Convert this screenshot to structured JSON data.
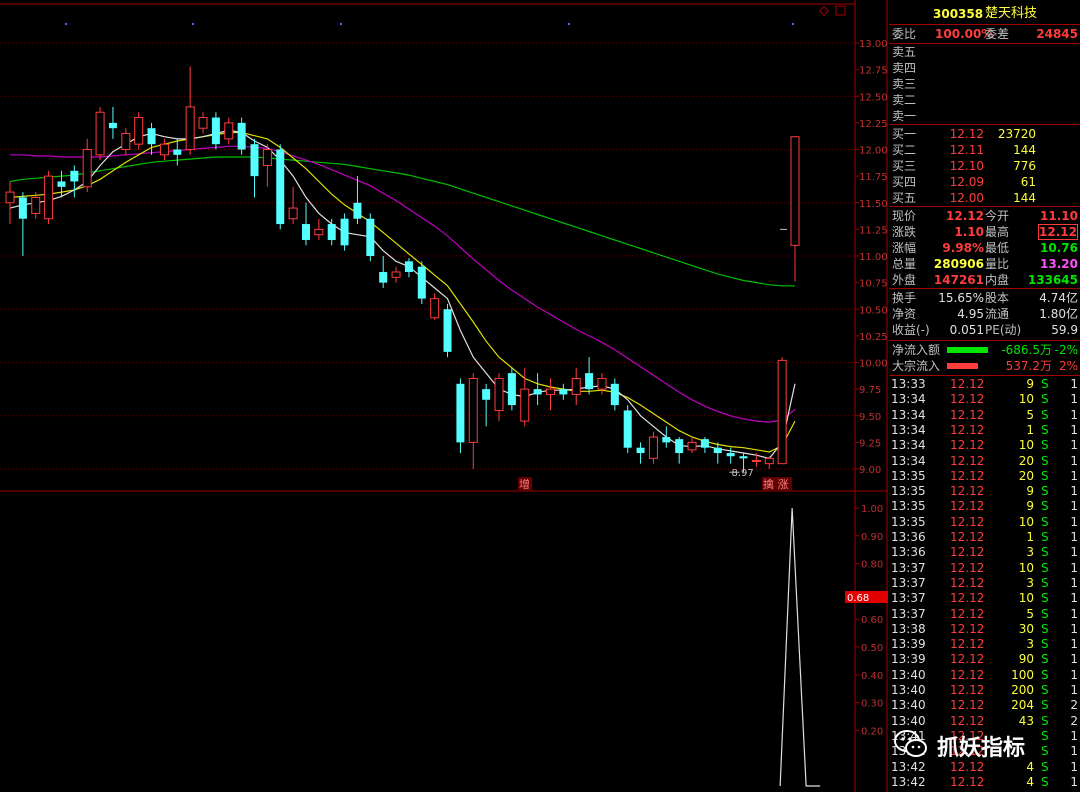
{
  "stock": {
    "code": "300358",
    "name": "楚天科技"
  },
  "weibi": {
    "label": "委比",
    "value": "100.00%",
    "diff_label": "委差",
    "diff_value": "24845"
  },
  "sells": [
    {
      "label": "卖五"
    },
    {
      "label": "卖四"
    },
    {
      "label": "卖三"
    },
    {
      "label": "卖二"
    },
    {
      "label": "卖一"
    }
  ],
  "buys": [
    {
      "label": "买一",
      "price": "12.12",
      "vol": "23720"
    },
    {
      "label": "买二",
      "price": "12.11",
      "vol": "144"
    },
    {
      "label": "买三",
      "price": "12.10",
      "vol": "776"
    },
    {
      "label": "买四",
      "price": "12.09",
      "vol": "61"
    },
    {
      "label": "买五",
      "price": "12.00",
      "vol": "144"
    }
  ],
  "quote": [
    {
      "l1": "现价",
      "v1": "12.12",
      "l2": "今开",
      "v2": "11.10",
      "c1": "red",
      "c2": "red"
    },
    {
      "l1": "涨跌",
      "v1": "1.10",
      "l2": "最高",
      "v2": "12.12",
      "c1": "red",
      "c2": "red"
    },
    {
      "l1": "涨幅",
      "v1": "9.98%",
      "l2": "最低",
      "v2": "10.76",
      "c1": "red",
      "c2": "grn"
    },
    {
      "l1": "总量",
      "v1": "280906",
      "l2": "量比",
      "v2": "13.20",
      "c1": "yel",
      "c2": "mag"
    },
    {
      "l1": "外盘",
      "v1": "147261",
      "l2": "内盘",
      "v2": "133645",
      "c1": "red",
      "c2": "grn"
    }
  ],
  "fund": [
    {
      "l1": "换手",
      "v1": "15.65%",
      "l2": "股本",
      "v2": "4.74亿"
    },
    {
      "l1": "净资",
      "v1": "4.95",
      "l2": "流通",
      "v2": "1.80亿"
    },
    {
      "l1": "收益(-)",
      "v1": "0.051",
      "l2": "PE(动)",
      "v2": "59.9"
    }
  ],
  "flows": [
    {
      "label": "净流入额",
      "value": "-686.5万",
      "pct": "-2%",
      "color": "#00e600",
      "bar": 0.45
    },
    {
      "label": "大宗流入",
      "value": "537.2万",
      "pct": "2%",
      "color": "#ff3c3c",
      "bar": 0.35
    }
  ],
  "ticks": [
    {
      "t": "13:33",
      "p": "12.12",
      "v": "9",
      "s": "S",
      "n": "1"
    },
    {
      "t": "13:34",
      "p": "12.12",
      "v": "10",
      "s": "S",
      "n": "1"
    },
    {
      "t": "13:34",
      "p": "12.12",
      "v": "5",
      "s": "S",
      "n": "1"
    },
    {
      "t": "13:34",
      "p": "12.12",
      "v": "1",
      "s": "S",
      "n": "1"
    },
    {
      "t": "13:34",
      "p": "12.12",
      "v": "10",
      "s": "S",
      "n": "1"
    },
    {
      "t": "13:34",
      "p": "12.12",
      "v": "20",
      "s": "S",
      "n": "1"
    },
    {
      "t": "13:35",
      "p": "12.12",
      "v": "20",
      "s": "S",
      "n": "1"
    },
    {
      "t": "13:35",
      "p": "12.12",
      "v": "9",
      "s": "S",
      "n": "1"
    },
    {
      "t": "13:35",
      "p": "12.12",
      "v": "9",
      "s": "S",
      "n": "1"
    },
    {
      "t": "13:35",
      "p": "12.12",
      "v": "10",
      "s": "S",
      "n": "1"
    },
    {
      "t": "13:36",
      "p": "12.12",
      "v": "1",
      "s": "S",
      "n": "1"
    },
    {
      "t": "13:36",
      "p": "12.12",
      "v": "3",
      "s": "S",
      "n": "1"
    },
    {
      "t": "13:37",
      "p": "12.12",
      "v": "10",
      "s": "S",
      "n": "1"
    },
    {
      "t": "13:37",
      "p": "12.12",
      "v": "3",
      "s": "S",
      "n": "1"
    },
    {
      "t": "13:37",
      "p": "12.12",
      "v": "10",
      "s": "S",
      "n": "1"
    },
    {
      "t": "13:37",
      "p": "12.12",
      "v": "5",
      "s": "S",
      "n": "1"
    },
    {
      "t": "13:38",
      "p": "12.12",
      "v": "30",
      "s": "S",
      "n": "1"
    },
    {
      "t": "13:39",
      "p": "12.12",
      "v": "3",
      "s": "S",
      "n": "1"
    },
    {
      "t": "13:39",
      "p": "12.12",
      "v": "90",
      "s": "S",
      "n": "1"
    },
    {
      "t": "13:40",
      "p": "12.12",
      "v": "100",
      "s": "S",
      "n": "1"
    },
    {
      "t": "13:40",
      "p": "12.12",
      "v": "200",
      "s": "S",
      "n": "1"
    },
    {
      "t": "13:40",
      "p": "12.12",
      "v": "204",
      "s": "S",
      "n": "2"
    },
    {
      "t": "13:40",
      "p": "12.12",
      "v": "43",
      "s": "S",
      "n": "2"
    },
    {
      "t": "13:41",
      "p": "12.12",
      "v": "",
      "s": "S",
      "n": "1"
    },
    {
      "t": "13:41",
      "p": "12.12",
      "v": "",
      "s": "S",
      "n": "1"
    },
    {
      "t": "13:42",
      "p": "12.12",
      "v": "4",
      "s": "S",
      "n": "1"
    },
    {
      "t": "13:42",
      "p": "12.12",
      "v": "4",
      "s": "S",
      "n": "1"
    }
  ],
  "watermark": {
    "text": "抓妖指标",
    "icon": "wechat-icon"
  },
  "chart_data": {
    "type": "candlestick",
    "price_axis": {
      "min": 9.0,
      "max": 13.0,
      "ticks": [
        "13.00",
        "12.75",
        "12.50",
        "12.25",
        "12.00",
        "11.75",
        "11.50",
        "11.25",
        "11.00",
        "10.75",
        "10.50",
        "10.25",
        "10.00",
        "9.75",
        "9.50",
        "9.25",
        "9.00"
      ]
    },
    "indicator_axis": {
      "ticks": [
        "1.00",
        "0.90",
        "0.80",
        "0.60",
        "0.50",
        "0.40",
        "0.30",
        "0.20"
      ],
      "current": "0.68"
    },
    "annotations": {
      "low_label": "8.97",
      "marker_left": "增",
      "marker_right": "擒 涨"
    },
    "candles": [
      {
        "o": 11.5,
        "c": 11.6,
        "h": 11.7,
        "l": 11.3
      },
      {
        "o": 11.55,
        "c": 11.35,
        "h": 11.6,
        "l": 11.0
      },
      {
        "o": 11.4,
        "c": 11.55,
        "h": 11.6,
        "l": 11.35
      },
      {
        "o": 11.35,
        "c": 11.75,
        "h": 11.8,
        "l": 11.3
      },
      {
        "o": 11.7,
        "c": 11.65,
        "h": 11.8,
        "l": 11.55
      },
      {
        "o": 11.8,
        "c": 11.7,
        "h": 11.85,
        "l": 11.55
      },
      {
        "o": 11.65,
        "c": 12.0,
        "h": 12.1,
        "l": 11.6
      },
      {
        "o": 11.95,
        "c": 12.35,
        "h": 12.4,
        "l": 11.9
      },
      {
        "o": 12.25,
        "c": 12.2,
        "h": 12.4,
        "l": 12.1
      },
      {
        "o": 12.0,
        "c": 12.15,
        "h": 12.2,
        "l": 11.95
      },
      {
        "o": 12.05,
        "c": 12.3,
        "h": 12.35,
        "l": 12.0
      },
      {
        "o": 12.2,
        "c": 12.05,
        "h": 12.25,
        "l": 11.95
      },
      {
        "o": 11.95,
        "c": 12.05,
        "h": 12.1,
        "l": 11.9
      },
      {
        "o": 12.0,
        "c": 11.95,
        "h": 12.1,
        "l": 11.85
      },
      {
        "o": 12.0,
        "c": 12.4,
        "h": 12.78,
        "l": 11.95
      },
      {
        "o": 12.2,
        "c": 12.3,
        "h": 12.35,
        "l": 12.15
      },
      {
        "o": 12.3,
        "c": 12.05,
        "h": 12.35,
        "l": 12.0
      },
      {
        "o": 12.1,
        "c": 12.25,
        "h": 12.3,
        "l": 12.05
      },
      {
        "o": 12.25,
        "c": 12.0,
        "h": 12.3,
        "l": 11.95
      },
      {
        "o": 12.05,
        "c": 11.75,
        "h": 12.1,
        "l": 11.55
      },
      {
        "o": 11.85,
        "c": 12.0,
        "h": 12.05,
        "l": 11.65
      },
      {
        "o": 12.0,
        "c": 11.3,
        "h": 12.05,
        "l": 11.25
      },
      {
        "o": 11.35,
        "c": 11.45,
        "h": 11.65,
        "l": 11.3
      },
      {
        "o": 11.3,
        "c": 11.15,
        "h": 11.5,
        "l": 11.1
      },
      {
        "o": 11.2,
        "c": 11.25,
        "h": 11.35,
        "l": 11.15
      },
      {
        "o": 11.3,
        "c": 11.15,
        "h": 11.35,
        "l": 11.1
      },
      {
        "o": 11.35,
        "c": 11.1,
        "h": 11.4,
        "l": 11.05
      },
      {
        "o": 11.5,
        "c": 11.35,
        "h": 11.75,
        "l": 11.3
      },
      {
        "o": 11.35,
        "c": 11.0,
        "h": 11.4,
        "l": 10.95
      },
      {
        "o": 10.85,
        "c": 10.75,
        "h": 11.0,
        "l": 10.7
      },
      {
        "o": 10.8,
        "c": 10.85,
        "h": 10.9,
        "l": 10.75
      },
      {
        "o": 10.95,
        "c": 10.85,
        "h": 10.98,
        "l": 10.8
      },
      {
        "o": 10.9,
        "c": 10.6,
        "h": 10.95,
        "l": 10.55
      },
      {
        "o": 10.42,
        "c": 10.6,
        "h": 10.65,
        "l": 10.4
      },
      {
        "o": 10.5,
        "c": 10.1,
        "h": 10.55,
        "l": 10.05
      },
      {
        "o": 9.8,
        "c": 9.25,
        "h": 9.85,
        "l": 9.15
      },
      {
        "o": 9.25,
        "c": 9.85,
        "h": 9.9,
        "l": 9.0
      },
      {
        "o": 9.75,
        "c": 9.65,
        "h": 9.8,
        "l": 9.4
      },
      {
        "o": 9.55,
        "c": 9.85,
        "h": 9.9,
        "l": 9.45
      },
      {
        "o": 9.9,
        "c": 9.6,
        "h": 9.95,
        "l": 9.55
      },
      {
        "o": 9.45,
        "c": 9.75,
        "h": 9.95,
        "l": 9.4
      },
      {
        "o": 9.75,
        "c": 9.7,
        "h": 9.9,
        "l": 9.6
      },
      {
        "o": 9.7,
        "c": 9.75,
        "h": 9.85,
        "l": 9.55
      },
      {
        "o": 9.75,
        "c": 9.7,
        "h": 9.8,
        "l": 9.65
      },
      {
        "o": 9.7,
        "c": 9.85,
        "h": 9.95,
        "l": 9.6
      },
      {
        "o": 9.9,
        "c": 9.75,
        "h": 10.05,
        "l": 9.7
      },
      {
        "o": 9.75,
        "c": 9.85,
        "h": 9.9,
        "l": 9.7
      },
      {
        "o": 9.8,
        "c": 9.6,
        "h": 9.85,
        "l": 9.55
      },
      {
        "o": 9.55,
        "c": 9.2,
        "h": 9.6,
        "l": 9.15
      },
      {
        "o": 9.2,
        "c": 9.15,
        "h": 9.25,
        "l": 9.05
      },
      {
        "o": 9.1,
        "c": 9.3,
        "h": 9.35,
        "l": 9.05
      },
      {
        "o": 9.3,
        "c": 9.25,
        "h": 9.4,
        "l": 9.2
      },
      {
        "o": 9.28,
        "c": 9.15,
        "h": 9.3,
        "l": 9.05
      },
      {
        "o": 9.18,
        "c": 9.25,
        "h": 9.3,
        "l": 9.15
      },
      {
        "o": 9.28,
        "c": 9.2,
        "h": 9.3,
        "l": 9.15
      },
      {
        "o": 9.2,
        "c": 9.15,
        "h": 9.25,
        "l": 9.05
      },
      {
        "o": 9.15,
        "c": 9.12,
        "h": 9.2,
        "l": 9.05
      },
      {
        "o": 9.12,
        "c": 9.1,
        "h": 9.15,
        "l": 8.97
      },
      {
        "o": 9.08,
        "c": 9.08,
        "h": 9.15,
        "l": 9.02
      },
      {
        "o": 9.05,
        "c": 9.1,
        "h": 9.12,
        "l": 9.0
      },
      {
        "o": 9.05,
        "c": 10.02,
        "h": 10.05,
        "l": 9.05
      },
      {
        "o": 11.1,
        "c": 12.12,
        "h": 12.12,
        "l": 10.76
      }
    ],
    "ma5": [
      11.45,
      11.48,
      11.5,
      11.52,
      11.56,
      11.62,
      11.7,
      11.85,
      11.98,
      12.05,
      12.12,
      12.15,
      12.12,
      12.1,
      12.1,
      12.12,
      12.15,
      12.18,
      12.16,
      12.08,
      12.02,
      11.9,
      11.75,
      11.55,
      11.4,
      11.3,
      11.22,
      11.2,
      11.18,
      11.05,
      10.95,
      10.9,
      10.8,
      10.7,
      10.6,
      10.3,
      10.05,
      9.9,
      9.75,
      9.7,
      9.68,
      9.72,
      9.74,
      9.74,
      9.75,
      9.77,
      9.78,
      9.75,
      9.65,
      9.5,
      9.4,
      9.3,
      9.22,
      9.21,
      9.22,
      9.19,
      9.17,
      9.15,
      9.13,
      9.1,
      9.25,
      9.8
    ],
    "ma10": [
      11.55,
      11.56,
      11.57,
      11.58,
      11.6,
      11.62,
      11.66,
      11.72,
      11.8,
      11.88,
      11.95,
      12.02,
      12.05,
      12.08,
      12.1,
      12.12,
      12.14,
      12.16,
      12.16,
      12.13,
      12.1,
      12.02,
      11.92,
      11.82,
      11.7,
      11.58,
      11.48,
      11.4,
      11.32,
      11.22,
      11.12,
      11.02,
      10.92,
      10.82,
      10.72,
      10.55,
      10.38,
      10.2,
      10.05,
      9.95,
      9.85,
      9.8,
      9.77,
      9.75,
      9.73,
      9.73,
      9.74,
      9.72,
      9.67,
      9.6,
      9.52,
      9.44,
      9.36,
      9.3,
      9.26,
      9.23,
      9.21,
      9.2,
      9.18,
      9.16,
      9.22,
      9.45
    ],
    "ma20": [
      11.95,
      11.95,
      11.94,
      11.94,
      11.93,
      11.93,
      11.93,
      11.93,
      11.94,
      11.95,
      11.96,
      11.97,
      11.98,
      11.99,
      12.0,
      12.01,
      12.02,
      12.03,
      12.03,
      12.02,
      12.01,
      11.98,
      11.94,
      11.9,
      11.86,
      11.81,
      11.76,
      11.71,
      11.66,
      11.59,
      11.52,
      11.44,
      11.36,
      11.28,
      11.19,
      11.08,
      10.97,
      10.87,
      10.77,
      10.68,
      10.6,
      10.52,
      10.45,
      10.38,
      10.31,
      10.25,
      10.19,
      10.12,
      10.04,
      9.96,
      9.88,
      9.8,
      9.72,
      9.65,
      9.59,
      9.54,
      9.5,
      9.47,
      9.45,
      9.44,
      9.46,
      9.56
    ],
    "ma60": [
      11.7,
      11.72,
      11.73,
      11.74,
      11.75,
      11.76,
      11.78,
      11.8,
      11.82,
      11.84,
      11.86,
      11.88,
      11.89,
      11.9,
      11.91,
      11.92,
      11.93,
      11.93,
      11.93,
      11.93,
      11.92,
      11.91,
      11.9,
      11.89,
      11.88,
      11.87,
      11.86,
      11.84,
      11.82,
      11.8,
      11.78,
      11.76,
      11.73,
      11.7,
      11.67,
      11.63,
      11.59,
      11.55,
      11.51,
      11.47,
      11.43,
      11.39,
      11.35,
      11.31,
      11.27,
      11.23,
      11.19,
      11.15,
      11.11,
      11.07,
      11.03,
      10.99,
      10.95,
      10.91,
      10.87,
      10.83,
      10.8,
      10.77,
      10.75,
      10.73,
      10.72,
      10.72
    ],
    "indicator": {
      "peak_index": 60,
      "peak_value": 1.0
    }
  }
}
